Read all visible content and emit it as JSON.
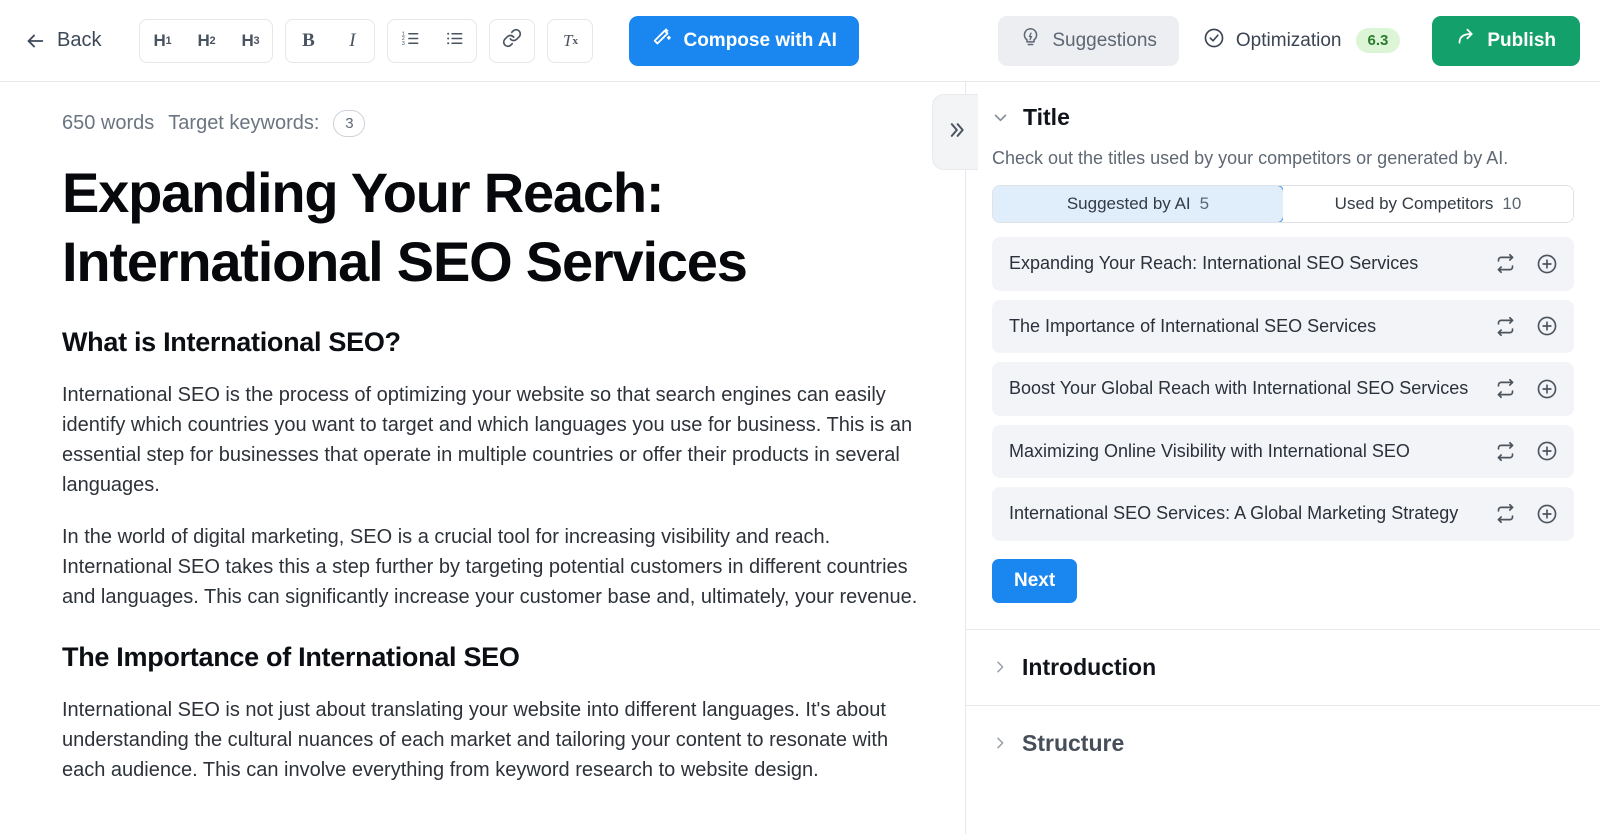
{
  "toolbar": {
    "back_label": "Back",
    "headings": [
      {
        "name": "h1-button",
        "label": "H",
        "sub": "1"
      },
      {
        "name": "h2-button",
        "label": "H",
        "sub": "2"
      },
      {
        "name": "h3-button",
        "label": "H",
        "sub": "3"
      }
    ],
    "bold_label": "B",
    "italic_label": "I",
    "clear_format_label": "T",
    "clear_format_sub": "x",
    "compose_label": "Compose with AI",
    "suggestions_label": "Suggestions",
    "optimization_label": "Optimization",
    "optimization_score": "6.3",
    "publish_label": "Publish"
  },
  "editor": {
    "word_count": "650 words",
    "target_keywords_label": "Target keywords:",
    "target_keywords_count": "3",
    "title": "Expanding Your Reach: International SEO Services",
    "blocks": [
      {
        "type": "h2",
        "text": "What is International SEO?"
      },
      {
        "type": "p",
        "text": "International SEO is the process of optimizing your website so that search engines can easily identify which countries you want to target and which languages you use for business. This is an essential step for businesses that operate in multiple countries or offer their products in several languages."
      },
      {
        "type": "p",
        "text": "In the world of digital marketing, SEO is a crucial tool for increasing visibility and reach. International SEO takes this a step further by targeting potential customers in different countries and languages. This can significantly increase your customer base and, ultimately, your revenue."
      },
      {
        "type": "h2",
        "text": "The Importance of International SEO"
      },
      {
        "type": "p",
        "text": "International SEO is not just about translating your website into different languages. It's about understanding the cultural nuances of each market and tailoring your content to resonate with each audience. This can involve everything from keyword research to website design."
      }
    ]
  },
  "panel": {
    "title_section": {
      "heading": "Title",
      "description": "Check out the titles used by your competitors or generated by AI.",
      "tabs": [
        {
          "label": "Suggested by AI",
          "count": "5",
          "active": true
        },
        {
          "label": "Used by Competitors",
          "count": "10",
          "active": false
        }
      ],
      "suggestions": [
        "Expanding Your Reach: International SEO Services",
        "The Importance of International SEO Services",
        "Boost Your Global Reach with International SEO Services",
        "Maximizing Online Visibility with International SEO",
        "International SEO Services: A Global Marketing Strategy"
      ],
      "next_label": "Next"
    },
    "collapsed_sections": [
      {
        "heading": "Introduction"
      },
      {
        "heading": "Structure"
      }
    ]
  },
  "colors": {
    "primary_blue": "#1a86f0",
    "publish_green": "#14a06a",
    "score_green": "#2b7c2b",
    "score_bg": "#ddf5d7",
    "item_bg": "#f2f4f7",
    "active_tab_bg": "#e0eefb"
  }
}
